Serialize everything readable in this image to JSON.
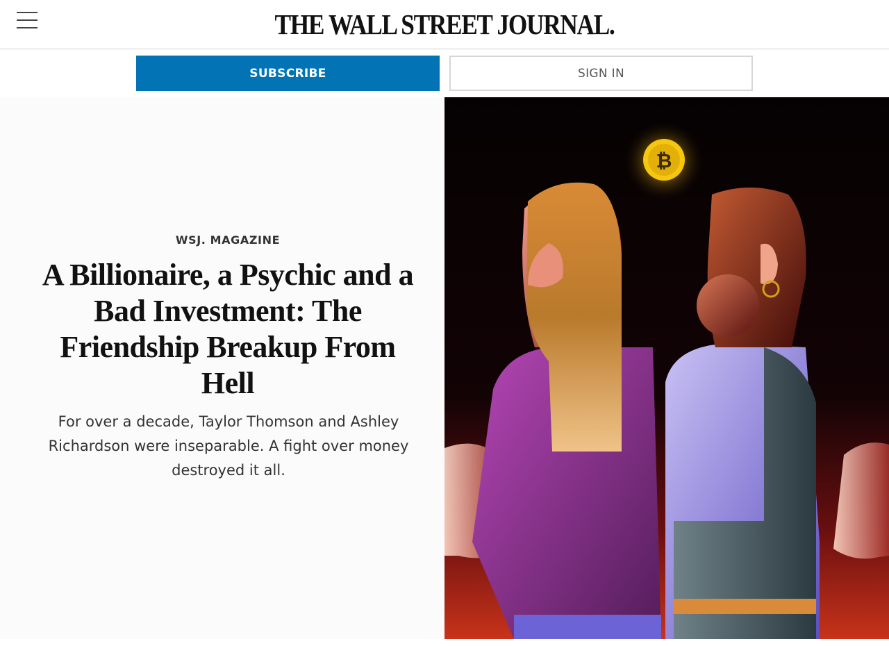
{
  "header": {
    "masthead": "THE WALL STREET JOURNAL.",
    "menu_icon": "hamburger-menu-icon"
  },
  "auth": {
    "subscribe_label": "SUBSCRIBE",
    "signin_label": "SIGN IN"
  },
  "article": {
    "section": "WSJ. MAGAZINE",
    "headline": "A Billionaire, a Psychic and a Bad Investment: The Friendship Breakup From Hell",
    "dek": "For over a decade, Taylor Thomson and Ashley Richardson were inseparable. A fight over money destroyed it all."
  },
  "illustration": {
    "coin_symbol": "₿",
    "icon": "bitcoin-icon"
  },
  "colors": {
    "accent": "#0274b6",
    "masthead": "#111111",
    "coin": "#f2c40f"
  }
}
